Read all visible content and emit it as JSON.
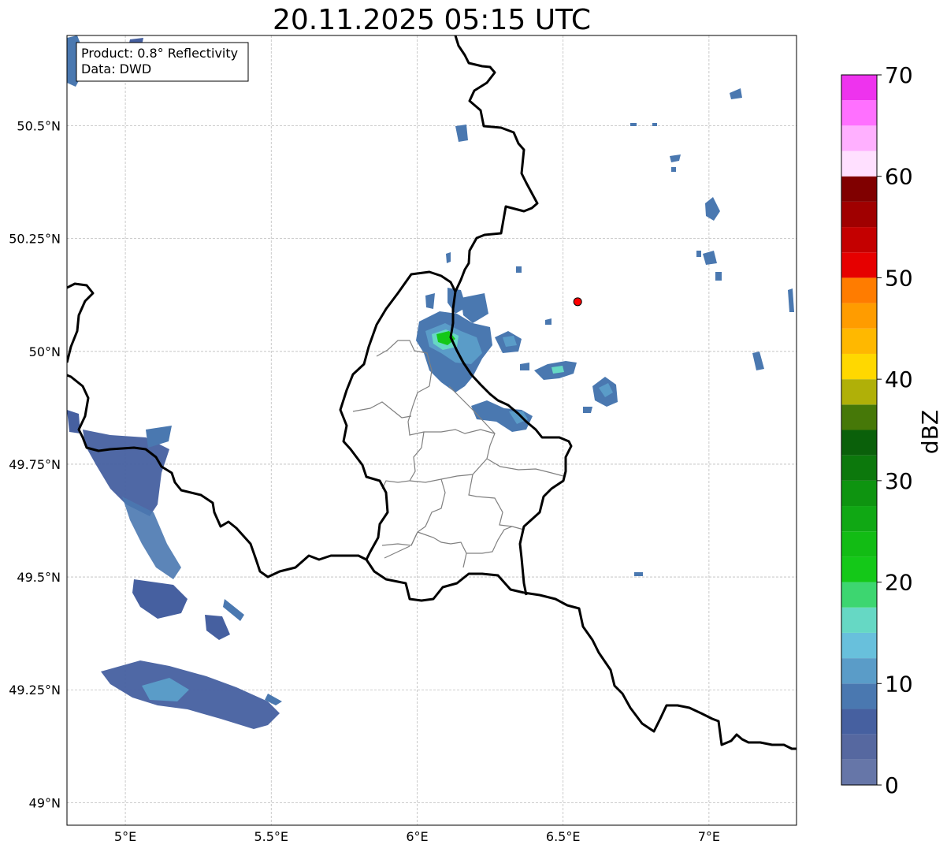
{
  "title": "20.11.2025 05:15 UTC",
  "info_box": {
    "line1": "Product: 0.8° Reflectivity",
    "line2": "Data: DWD"
  },
  "map": {
    "lon_range": [
      4.8,
      7.3
    ],
    "lat_range": [
      48.95,
      50.7
    ],
    "x_ticks": [
      {
        "value": 5.0,
        "label": "5°E"
      },
      {
        "value": 5.5,
        "label": "5.5°E"
      },
      {
        "value": 6.0,
        "label": "6°E"
      },
      {
        "value": 6.5,
        "label": "6.5°E"
      },
      {
        "value": 7.0,
        "label": "7°E"
      }
    ],
    "y_ticks": [
      {
        "value": 50.5,
        "label": "50.5°N"
      },
      {
        "value": 50.25,
        "label": "50.25°N"
      },
      {
        "value": 50.0,
        "label": "50°N"
      },
      {
        "value": 49.75,
        "label": "49.75°N"
      },
      {
        "value": 49.5,
        "label": "49.5°N"
      },
      {
        "value": 49.25,
        "label": "49.25°N"
      },
      {
        "value": 49.0,
        "label": "49°N"
      }
    ],
    "grid": true,
    "marker": {
      "lon": 6.55,
      "lat": 50.11,
      "color": "#ff0000"
    }
  },
  "colorbar": {
    "label": "dBZ",
    "min": 0,
    "max": 70,
    "step": 2.5,
    "ticks": [
      {
        "value": 0,
        "label": "0"
      },
      {
        "value": 10,
        "label": "10"
      },
      {
        "value": 20,
        "label": "20"
      },
      {
        "value": 30,
        "label": "30"
      },
      {
        "value": 40,
        "label": "40"
      },
      {
        "value": 50,
        "label": "50"
      },
      {
        "value": 60,
        "label": "60"
      },
      {
        "value": 70,
        "label": "70"
      }
    ],
    "colors": [
      "#6676a8",
      "#5668a0",
      "#4660a0",
      "#4a78b0",
      "#5a9cc8",
      "#68c0dc",
      "#66d8c4",
      "#3dd670",
      "#14c818",
      "#12bc14",
      "#10a814",
      "#0e9410",
      "#0c780c",
      "#0a600a",
      "#467808",
      "#b0b008",
      "#ffd800",
      "#ffb800",
      "#ff9c00",
      "#ff7c00",
      "#e60000",
      "#c40000",
      "#a00000",
      "#800000",
      "#ffe0ff",
      "#ffb0ff",
      "#ff70ff",
      "#ee33ee"
    ]
  },
  "echo_colors": {
    "weak": "#4660a0",
    "light": "#5a9cc8",
    "medium": "#66d8c4",
    "strong": "#14c818"
  }
}
